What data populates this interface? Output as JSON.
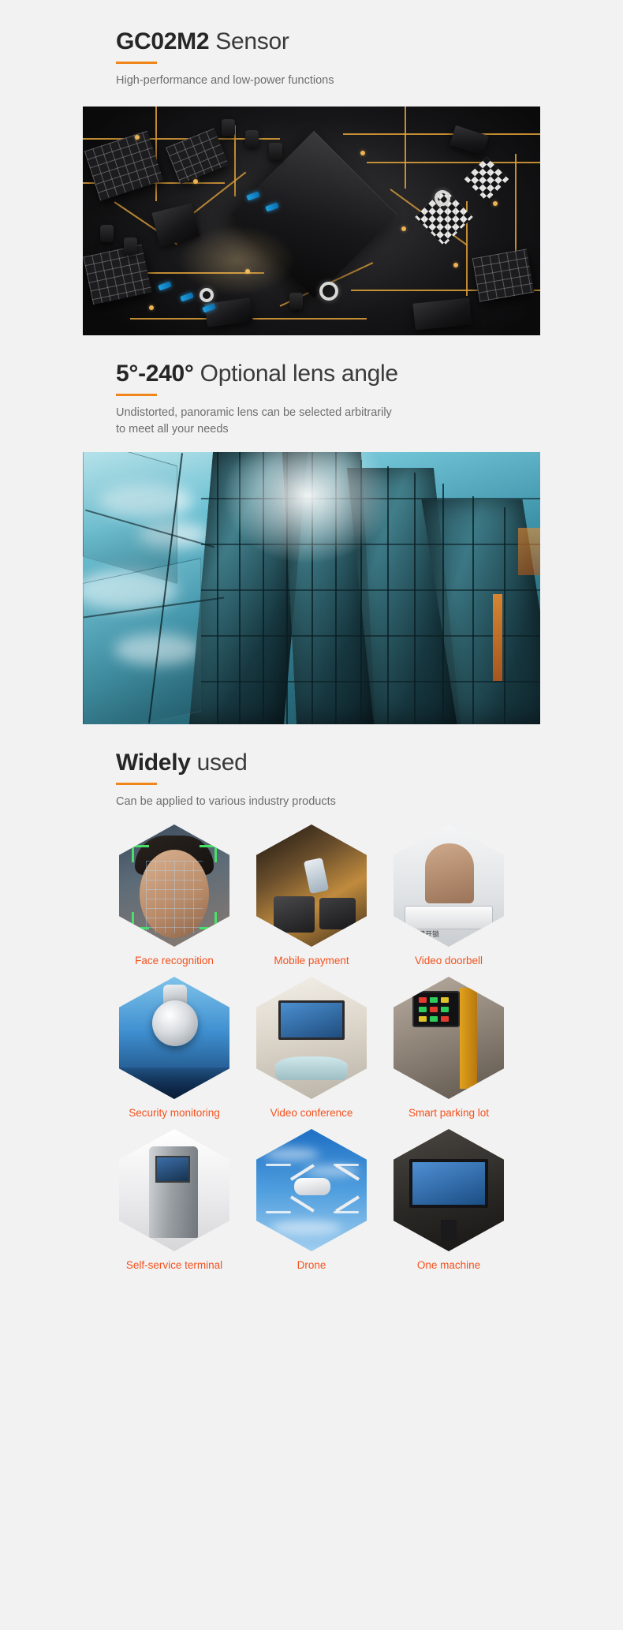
{
  "sections": [
    {
      "heading_strong": "GC02M2",
      "heading_light": " Sensor",
      "subtitle_line1": "High-performance and low-power functions",
      "subtitle_line2": ""
    },
    {
      "heading_strong": "5°-240°",
      "heading_light": " Optional lens angle",
      "subtitle_line1": "Undistorted, panoramic lens can be selected arbitrarily",
      "subtitle_line2": "to meet all your needs"
    },
    {
      "heading_strong": "Widely",
      "heading_light": " used",
      "subtitle_line1": "Can be applied to various industry products",
      "subtitle_line2": ""
    }
  ],
  "applications": [
    {
      "label": "Face recognition",
      "scene": "face-recognition-photo"
    },
    {
      "label": "Mobile payment",
      "scene": "mobile-payment-photo"
    },
    {
      "label": "Video doorbell",
      "scene": "video-doorbell-photo"
    },
    {
      "label": "Security monitoring",
      "scene": "security-camera-photo"
    },
    {
      "label": "Video conference",
      "scene": "video-conference-photo"
    },
    {
      "label": "Smart parking lot",
      "scene": "smart-parking-photo"
    },
    {
      "label": "Self-service terminal",
      "scene": "self-service-kiosk-photo"
    },
    {
      "label": "Drone",
      "scene": "drone-photo"
    },
    {
      "label": "One machine",
      "scene": "one-machine-photo"
    }
  ],
  "doorbell_caption": "一键开锁",
  "colors": {
    "accent": "#f08519",
    "label": "#f4511e",
    "heading": "#2f2f2f",
    "subtitle": "#6d6d6d",
    "page_bg": "#f2f2f2"
  }
}
